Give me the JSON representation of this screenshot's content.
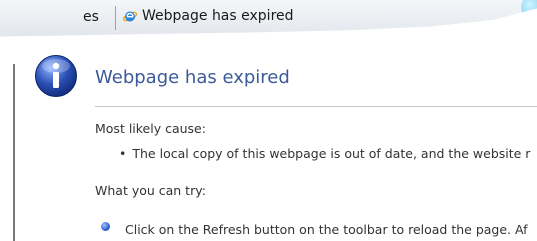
{
  "tabs": {
    "partial_label": "es",
    "active_label": "Webpage has expired",
    "active_icon": "ie-logo-icon"
  },
  "error": {
    "icon": "info-icon",
    "heading": "Webpage has expired",
    "cause_label": "Most likely cause:",
    "cause_bullet": "•",
    "cause_item": "The local copy of this webpage is out of date, and the website r",
    "try_label": "What you can try:",
    "try_item": "Click on the Refresh button on the toolbar to reload the page. Af"
  },
  "colors": {
    "heading": "#3a5a99",
    "info_icon": "#2a4fb5",
    "bullet_dot": "#1f55c8"
  }
}
